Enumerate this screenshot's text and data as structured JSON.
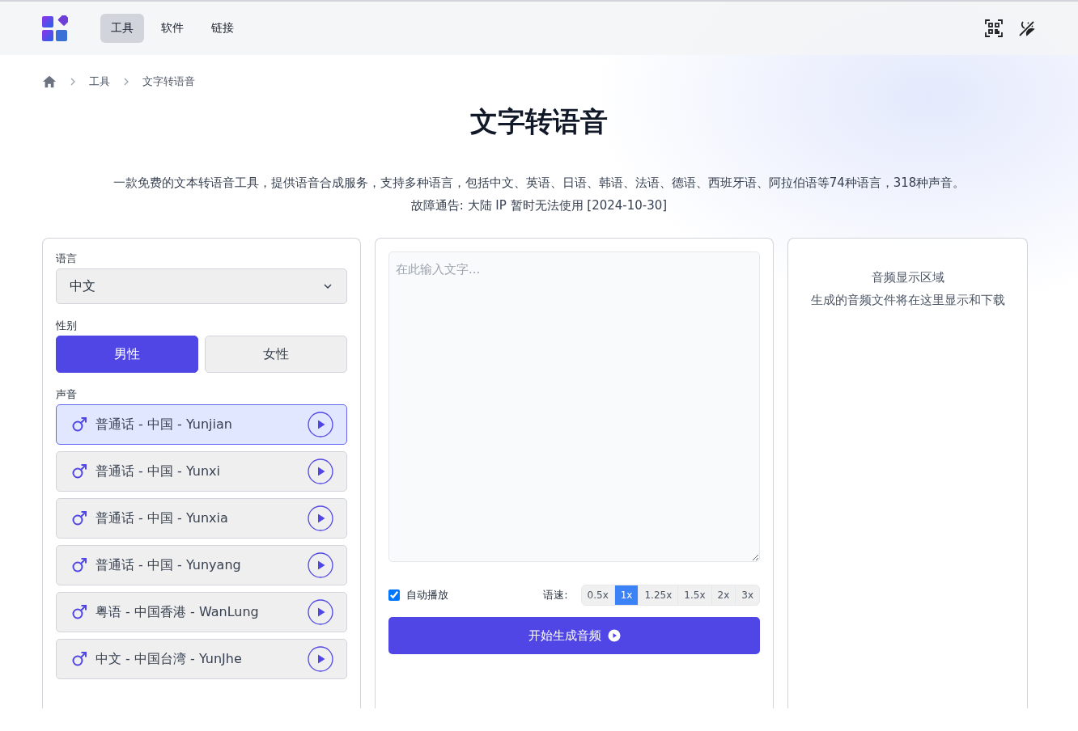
{
  "nav": {
    "items": [
      {
        "label": "工具",
        "selected": true
      },
      {
        "label": "软件",
        "selected": false
      },
      {
        "label": "链接",
        "selected": false
      }
    ]
  },
  "breadcrumb": [
    "工具",
    "文字转语音"
  ],
  "title": "文字转语音",
  "description": [
    "一款免费的文本转语音工具，提供语音合成服务，支持多种语言，包括中文、英语、日语、韩语、法语、德语、西班牙语、阿拉伯语等74种语言，318种声音。",
    "故障通告: 大陆 IP 暂时无法使用 [2024-10-30]"
  ],
  "settings": {
    "language_label": "语言",
    "language": "中文",
    "gender_label": "性别",
    "genders": [
      {
        "label": "男性",
        "selected": true
      },
      {
        "label": "女性",
        "selected": false
      }
    ],
    "voice_label": "声音",
    "voices": [
      {
        "name": "普通话 - 中国 - Yunjian",
        "selected": true
      },
      {
        "name": "普通话 - 中国 - Yunxi",
        "selected": false
      },
      {
        "name": "普通话 - 中国 - Yunxia",
        "selected": false
      },
      {
        "name": "普通话 - 中国 - Yunyang",
        "selected": false
      },
      {
        "name": "粤语 - 中国香港 - WanLung",
        "selected": false
      },
      {
        "name": "中文 - 中国台湾 - YunJhe",
        "selected": false
      }
    ]
  },
  "editor": {
    "placeholder": "在此输入文字...",
    "autoplay": {
      "label": "自动播放",
      "checked": true
    },
    "speed_label": "语速:",
    "speeds": [
      {
        "label": "0.5x",
        "selected": false
      },
      {
        "label": "1x",
        "selected": true
      },
      {
        "label": "1.25x",
        "selected": false
      },
      {
        "label": "1.5x",
        "selected": false
      },
      {
        "label": "2x",
        "selected": false
      },
      {
        "label": "3x",
        "selected": false
      }
    ],
    "generate_button": "开始生成音频"
  },
  "output": {
    "title": "音频显示区域",
    "hint": "生成的音频文件将在这里显示和下载"
  }
}
